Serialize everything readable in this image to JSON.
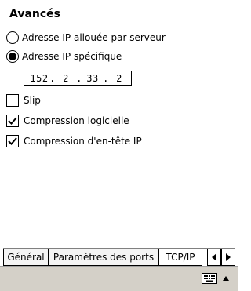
{
  "window": {
    "title": "Avancés"
  },
  "options": {
    "radio_server": "Adresse IP allouée par serveur",
    "radio_specific": "Adresse IP spécifique",
    "ip": {
      "seg1": "152",
      "seg2": "2",
      "seg3": "33",
      "seg4": "2",
      "separator": "."
    },
    "slip": "Slip",
    "soft_compression": "Compression logicielle",
    "header_compression": "Compression d'en-tête IP"
  },
  "tabs": {
    "general": "Général",
    "ports": "Paramètres des ports",
    "tcpip": "TCP/IP"
  },
  "icons": {
    "scroll_left": "left-arrow-icon",
    "scroll_right": "right-arrow-icon",
    "keyboard": "keyboard-icon",
    "sip_menu": "up-arrow-icon"
  }
}
